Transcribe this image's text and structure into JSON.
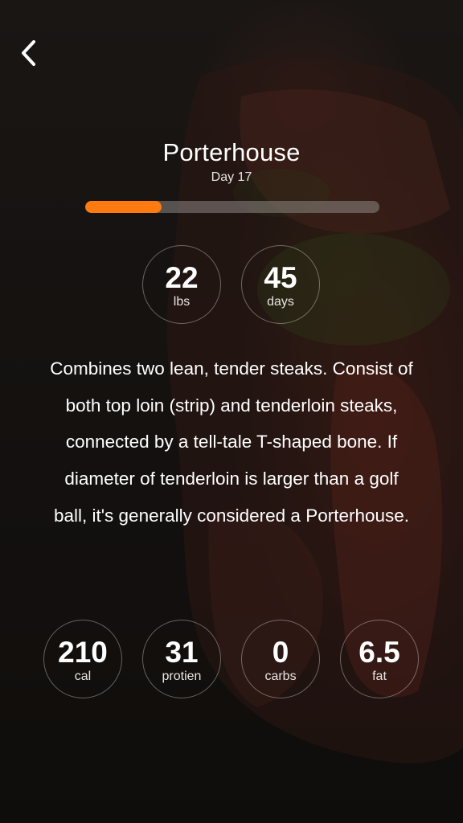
{
  "header": {
    "back_icon": "chevron-left-icon"
  },
  "cut": {
    "title": "Porterhouse",
    "subtitle": "Day 17",
    "progress_fraction": 0.26,
    "progress_color": "#ff7a10"
  },
  "stats": [
    {
      "value": "22",
      "unit": "lbs"
    },
    {
      "value": "45",
      "unit": "days"
    }
  ],
  "description": "Combines two lean, tender steaks. Consist of both top loin (strip) and tenderloin steaks, connected by a tell-tale T-shaped bone. If diameter of tenderloin is larger than a golf ball, it's generally considered a Porterhouse.",
  "nutrition": [
    {
      "value": "210",
      "unit": "cal"
    },
    {
      "value": "31",
      "unit": "protien"
    },
    {
      "value": "0",
      "unit": "carbs"
    },
    {
      "value": "6.5",
      "unit": "fat"
    }
  ]
}
